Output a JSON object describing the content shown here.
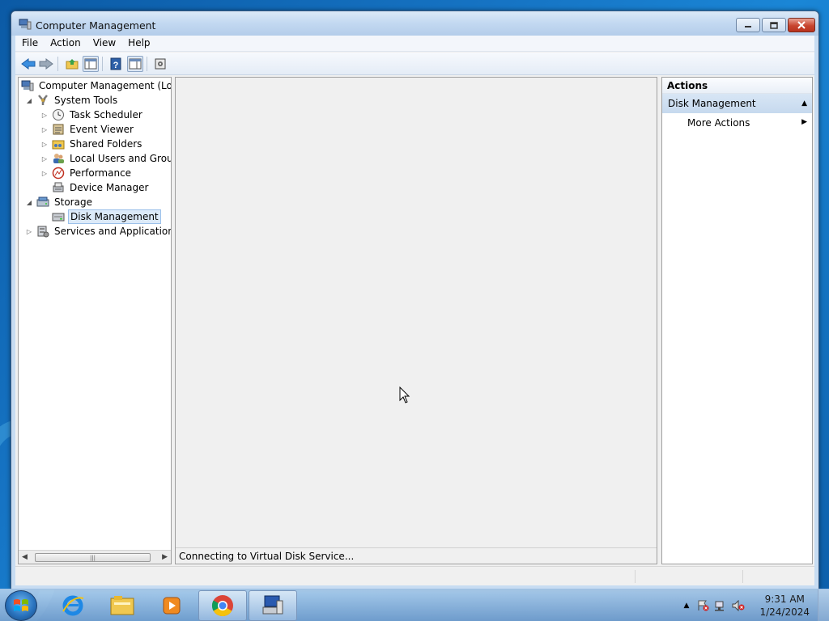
{
  "window": {
    "title": "Computer Management",
    "minimize_icon": "minimize-icon",
    "maximize_icon": "maximize-icon",
    "close_icon": "close-icon"
  },
  "menu": [
    "File",
    "Action",
    "View",
    "Help"
  ],
  "toolbar": {
    "icons": [
      "back-arrow-icon",
      "forward-arrow-icon",
      "up-folder-icon",
      "show-hide-console-tree-icon",
      "help-icon",
      "show-hide-action-pane-icon",
      "properties-icon"
    ]
  },
  "tree": {
    "root": "Computer Management (Local",
    "system_tools": "System Tools",
    "task_scheduler": "Task Scheduler",
    "event_viewer": "Event Viewer",
    "shared_folders": "Shared Folders",
    "local_users": "Local Users and Groups",
    "performance": "Performance",
    "device_manager": "Device Manager",
    "storage": "Storage",
    "disk_management": "Disk Management",
    "services": "Services and Applications"
  },
  "center": {
    "status": "Connecting to Virtual Disk Service..."
  },
  "actions": {
    "header": "Actions",
    "section": "Disk Management",
    "more": "More Actions"
  },
  "taskbar": {
    "items": [
      "start-orb",
      "internet-explorer",
      "windows-explorer",
      "media-player",
      "chrome",
      "computer-management"
    ],
    "time": "9:31 AM",
    "date": "1/24/2024"
  },
  "colors": {
    "desktop": "#1674c4",
    "titlebar": "#c2d8f1",
    "close_button": "#c8452f",
    "selection": "#dceaf9",
    "actions_section": "#c6d9ee"
  }
}
